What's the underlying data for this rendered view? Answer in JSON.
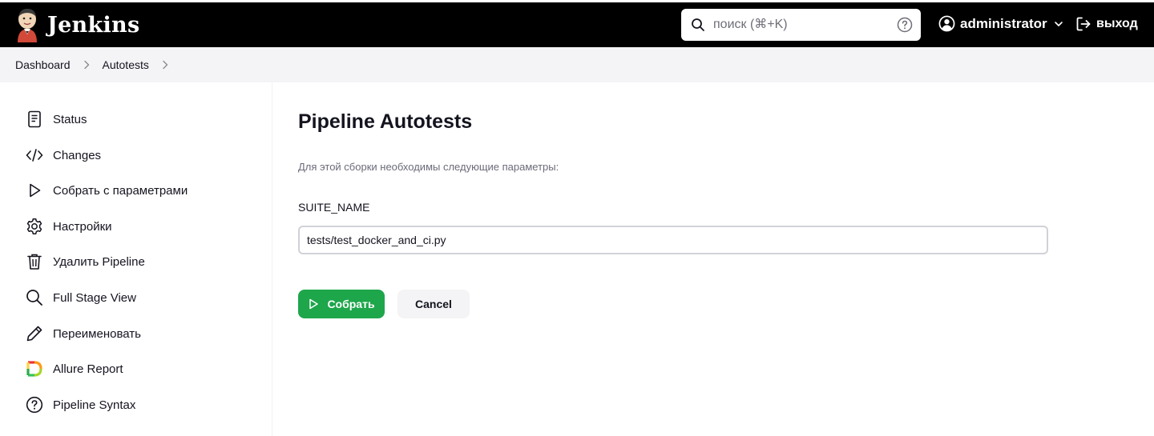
{
  "header": {
    "brand": "Jenkins",
    "search_placeholder": "поиск (⌘+K)",
    "user_name": "administrator",
    "logout_label": "выход"
  },
  "breadcrumb": [
    "Dashboard",
    "Autotests"
  ],
  "sidebar": {
    "items": [
      {
        "label": "Status",
        "icon": "document-icon"
      },
      {
        "label": "Changes",
        "icon": "code-icon"
      },
      {
        "label": "Собрать с параметрами",
        "icon": "play-icon"
      },
      {
        "label": "Настройки",
        "icon": "gear-icon"
      },
      {
        "label": "Удалить Pipeline",
        "icon": "trash-icon"
      },
      {
        "label": "Full Stage View",
        "icon": "search-icon"
      },
      {
        "label": "Переименовать",
        "icon": "pencil-icon"
      },
      {
        "label": "Allure Report",
        "icon": "allure-icon"
      },
      {
        "label": "Pipeline Syntax",
        "icon": "help-circle-icon"
      }
    ]
  },
  "main": {
    "title": "Pipeline Autotests",
    "description": "Для этой сборки необходимы следующие параметры:",
    "param_name": "SUITE_NAME",
    "param_value": "tests/test_docker_and_ci.py",
    "build_label": "Собрать",
    "cancel_label": "Cancel"
  },
  "colors": {
    "header_bg": "#000000",
    "breadcrumb_bg": "#f4f4f6",
    "build_button": "#1ea64b",
    "cancel_button": "#f4f4f6"
  }
}
